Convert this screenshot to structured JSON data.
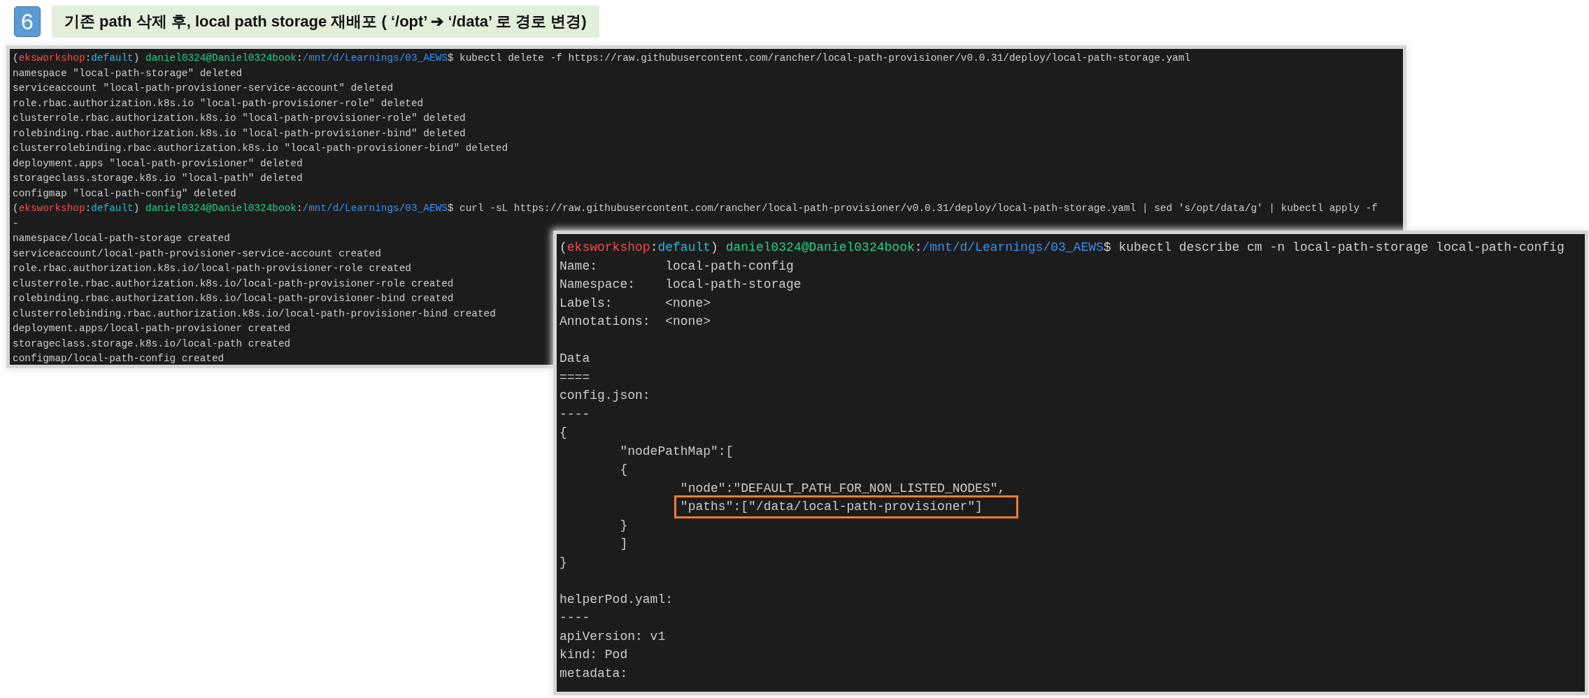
{
  "step": {
    "number": "6",
    "title": "기존 path 삭제 후, local path storage 재배포 ( ‘/opt’ ➔ ‘/data’ 로 경로 변경)"
  },
  "terminal_1": {
    "lines": [
      {
        "kind": "prompt",
        "segments": [
          {
            "text": "("
          },
          {
            "text": "eksworkshop",
            "color": "#f14c4c"
          },
          {
            "text": ":"
          },
          {
            "text": "default",
            "color": "#29b8db"
          },
          {
            "text": ") "
          },
          {
            "text": "daniel0324@Daniel0324book",
            "color": "#23d18b"
          },
          {
            "text": ":"
          },
          {
            "text": "/mnt/d/Learnings/03_AEWS",
            "color": "#3b8eea"
          },
          {
            "text": "$ kubectl delete -f https://raw.githubusercontent.com/rancher/local-path-provisioner/v0.0.31/deploy/local-path-storage.yaml"
          }
        ]
      },
      {
        "kind": "text",
        "text": "namespace \"local-path-storage\" deleted"
      },
      {
        "kind": "text",
        "text": "serviceaccount \"local-path-provisioner-service-account\" deleted"
      },
      {
        "kind": "text",
        "text": "role.rbac.authorization.k8s.io \"local-path-provisioner-role\" deleted"
      },
      {
        "kind": "text",
        "text": "clusterrole.rbac.authorization.k8s.io \"local-path-provisioner-role\" deleted"
      },
      {
        "kind": "text",
        "text": "rolebinding.rbac.authorization.k8s.io \"local-path-provisioner-bind\" deleted"
      },
      {
        "kind": "text",
        "text": "clusterrolebinding.rbac.authorization.k8s.io \"local-path-provisioner-bind\" deleted"
      },
      {
        "kind": "text",
        "text": "deployment.apps \"local-path-provisioner\" deleted"
      },
      {
        "kind": "text",
        "text": "storageclass.storage.k8s.io \"local-path\" deleted"
      },
      {
        "kind": "text",
        "text": "configmap \"local-path-config\" deleted"
      },
      {
        "kind": "prompt",
        "segments": [
          {
            "text": "("
          },
          {
            "text": "eksworkshop",
            "color": "#f14c4c"
          },
          {
            "text": ":"
          },
          {
            "text": "default",
            "color": "#29b8db"
          },
          {
            "text": ") "
          },
          {
            "text": "daniel0324@Daniel0324book",
            "color": "#23d18b"
          },
          {
            "text": ":"
          },
          {
            "text": "/mnt/d/Learnings/03_AEWS",
            "color": "#3b8eea"
          },
          {
            "text": "$ curl -sL https://raw.githubusercontent.com/rancher/local-path-provisioner/v0.0.31/deploy/local-path-storage.yaml | sed 's/opt/data/g' | kubectl apply -f"
          }
        ]
      },
      {
        "kind": "text",
        "text": "-"
      },
      {
        "kind": "text",
        "text": "namespace/local-path-storage created"
      },
      {
        "kind": "text",
        "text": "serviceaccount/local-path-provisioner-service-account created"
      },
      {
        "kind": "text",
        "text": "role.rbac.authorization.k8s.io/local-path-provisioner-role created"
      },
      {
        "kind": "text",
        "text": "clusterrole.rbac.authorization.k8s.io/local-path-provisioner-role created"
      },
      {
        "kind": "text",
        "text": "rolebinding.rbac.authorization.k8s.io/local-path-provisioner-bind created"
      },
      {
        "kind": "text",
        "text": "clusterrolebinding.rbac.authorization.k8s.io/local-path-provisioner-bind created"
      },
      {
        "kind": "text",
        "text": "deployment.apps/local-path-provisioner created"
      },
      {
        "kind": "text",
        "text": "storageclass.storage.k8s.io/local-path created"
      },
      {
        "kind": "text",
        "text": "configmap/local-path-config created"
      }
    ]
  },
  "terminal_2": {
    "lines": [
      {
        "kind": "prompt",
        "segments": [
          {
            "text": "("
          },
          {
            "text": "eksworkshop",
            "color": "#f14c4c"
          },
          {
            "text": ":"
          },
          {
            "text": "default",
            "color": "#29b8db"
          },
          {
            "text": ") "
          },
          {
            "text": "daniel0324@Daniel0324book",
            "color": "#23d18b"
          },
          {
            "text": ":"
          },
          {
            "text": "/mnt/d/Learnings/03_AEWS",
            "color": "#3b8eea"
          },
          {
            "text": "$ kubectl describe cm -n local-path-storage local-path-config"
          }
        ]
      },
      {
        "kind": "field",
        "key": "Name:",
        "value": "local-path-config"
      },
      {
        "kind": "field",
        "key": "Namespace:",
        "value": "local-path-storage"
      },
      {
        "kind": "field",
        "key": "Labels:",
        "value": "<none>"
      },
      {
        "kind": "field",
        "key": "Annotations:",
        "value": "<none>"
      },
      {
        "kind": "blank"
      },
      {
        "kind": "text",
        "text": "Data"
      },
      {
        "kind": "text",
        "text": "===="
      },
      {
        "kind": "text",
        "text": "config.json:"
      },
      {
        "kind": "text",
        "text": "----"
      },
      {
        "kind": "tree",
        "items": [
          {
            "text": "{",
            "highlighted": false,
            "children": [
              {
                "text": "\"nodePathMap\":[",
                "highlighted": false
              },
              {
                "text": "{",
                "highlighted": false,
                "children": [
                  {
                    "text": "\"node\":\"DEFAULT_PATH_FOR_NON_LISTED_NODES\",",
                    "highlighted": false
                  },
                  {
                    "text": "\"paths\":[\"/data/local-path-provisioner\"]",
                    "highlighted": true
                  }
                ]
              },
              {
                "text": "}",
                "highlighted": false
              },
              {
                "text": "]",
                "highlighted": false
              }
            ]
          },
          {
            "text": "}",
            "highlighted": false
          }
        ]
      },
      {
        "kind": "blank"
      },
      {
        "kind": "text",
        "text": "helperPod.yaml:"
      },
      {
        "kind": "text",
        "text": "----"
      },
      {
        "kind": "text",
        "text": "apiVersion: v1"
      },
      {
        "kind": "text",
        "text": "kind: Pod"
      },
      {
        "kind": "text",
        "text": "metadata:"
      }
    ]
  }
}
